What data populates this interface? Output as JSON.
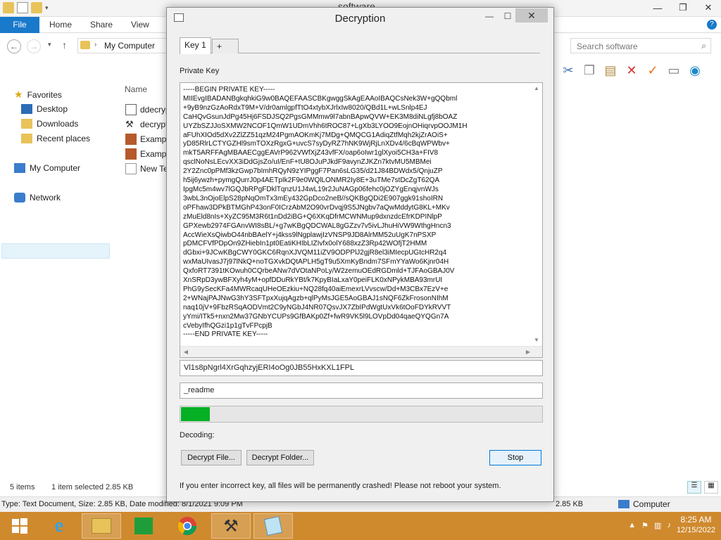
{
  "explorer": {
    "title": "software",
    "ribbon_tabs": [
      "File",
      "Home",
      "Share",
      "View"
    ],
    "address": "My Computer",
    "search_placeholder": "Search software",
    "nav": {
      "favorites": "Favorites",
      "desktop": "Desktop",
      "downloads": "Downloads",
      "recent": "Recent places",
      "my_computer": "My Computer",
      "network": "Network"
    },
    "column_name": "Name",
    "files": [
      "ddecryp",
      "decrypt",
      "Exampl",
      "Exampl",
      "New Te"
    ],
    "status": {
      "items": "5 items",
      "selected": "1 item selected  2.85 KB"
    },
    "details": {
      "left": "Type: Text Document, Size: 2.85 KB, Date modified: 8/1/2021 9:09 PM",
      "size": "2.85 KB",
      "computer": "Computer"
    }
  },
  "taskbar": {
    "time": "8:25 AM",
    "date": "12/15/2022"
  },
  "dialog": {
    "title": "Decryption",
    "tabs": [
      "Key 1",
      "+"
    ],
    "private_key_label": "Private Key",
    "private_key": "-----BEGIN PRIVATE KEY-----\nMIIEvgIBADANBgkqhkiG9w0BAQEFAASCBKgwggSkAgEAAoIBAQCsNek3W+gQQbml\n+9yB9nzGzAoRdxT9M+V/dr0amlgpfTtO4xtybXJrlxIw8020/QBd1L+wLSnlp4EJ\nCaHQvGsunJdPg45Hj6FSDJSQ2PgsGMMmw9l7abnBApwQVW+EK3M8diNLgfj8bOAZ\nUYZbSZJJoSXMW2NCOF1QmW1UDmVhh6tROC87+LgXb3LYOO9EojnOHiqrvpOOJM1H\naFUhXIOd5dXv2ZlZZ51qzM24PgmAOKmKj7MDg+QMQCG1AdiqZtfMqh2kjZrAOiS+\nyD85RlrLCTYGZHl9smTOXzRgxG+uvcS7syDyRZ7hNK9WjRjLnXDv4/6cBqWPWbv+\nmkT5ARFFAgMBAAECggEAVrP962VWfXjZ43vfFX/oap6oIwr1glXyoi5CH3a+FIV8\nqsclNoNsLEcvXX3iDdGjsZo/uI/EnF+tU8OJuPJkdF9avynZJKZn7ktvMU5MBMei\n2Y2Znc0pPMf3kzGwp7bImhRQyN9zYIPggF7Pan6sLG35/d21J84BDWdx5/QnjuZP\nh5ij6ywzh+pymgQurrJ0p4AETpIk2F9e0WQlLONMR2Iy8E+3uTMe7stDcZgT62QA\nIpgMc5m4wv7lGQJbRPgFDklTqnzU1J4wL19r2JuNAGp06fehc0jOZYgEnqjvnWJs\n3wbL3nOjoElpS28pNqOmTx3mEy432GpDco2neB//sQKBgQDi2E907ggk91shoIRN\noPFhaw3DPkBTMGhP43onF0ICrzAbM2O90vrDvqj9S5JNgbv7aQwMddytG8KL+MKv\nzMuEld8nIs+XyZC95M3R6t1nDd2iBG+Q6XKqDfrMCWNMup9dxnzdcEfrKDPINlpP\nGPXewb2974FGAnvWI8sBL/+g7wKBgQDCWAL8gGZzv7v5ivLJhuHiVW9WthgHncn3\nAccWieXsQiwbO44nbBAelY+j4kss9lNgplawjIzVNSP9JD8AlrMM52uUgK7nPSXP\npDMCFVfPDpOn9ZHiebIn1pt0EatiKHIbLIZIvfx0olY688xzZ3Rp42WOfjT2HMM\ndGbxi+9JCwKBgCWY0GKC6RqnXJVQM11iZV9ODPPlJ2gjR8el3iMIecpUGtcHR2q4\nwxMaUIvasJ7j97lNkQ+noTGXvkDQtAPLH5gT9u5XmKyBndm7SFmYYaWo6Kjnr04H\nQxfoRT7391tKOwuh0CQrbeANw7dVOtaNPoLy/W2zemuOEdRGDmld+TJFAoGBAJ0V\nXnSRpD3ywBFXyh4yM+opfDDuRkYBt/k7KpyBIaLxaY0peiFLK0xNPykMBA93mrUI\nPhG9ySecKFa4MWRcaqUHeOEzkiu+NQ28fq40aiEmexrLVvscw/Dd+M3CBx7EzV+e\n2+WNajPAJNwG3hY3SFTpxXujqAgzb+qlPyMsJGE5AoGBAJ1sNQF6ZkFrosonNIhM\nnaq10jV+9FbzRSqAODVmt2C9yNGbJ4NR07QsvJX7ZbIPdWgtUxVk6tOoFDYkRVVT\nyYmi/ITk5+nxn2Mw37GNbYCUPs9GfBAKp0Zf+fwR9VK5l9LOVpDd04qaeQYQGn7A\ncVebyIfhQGzi1p1gTvFPcpjB\n-----END PRIVATE KEY-----",
    "id_value": "Vl1s8pNgrl4XrGqhzyjERI4oOg0JB55HxKXL1FPL",
    "ext_value": "_readme",
    "progress": 0.08,
    "progress_color": "#06b025",
    "status_label": "Decoding:",
    "buttons": {
      "decrypt_file": "Decrypt File...",
      "decrypt_folder": "Decrypt Folder...",
      "stop": "Stop"
    },
    "warning": "If you enter incorrect key, all files will be permanently crashed! Please not reboot your system."
  }
}
